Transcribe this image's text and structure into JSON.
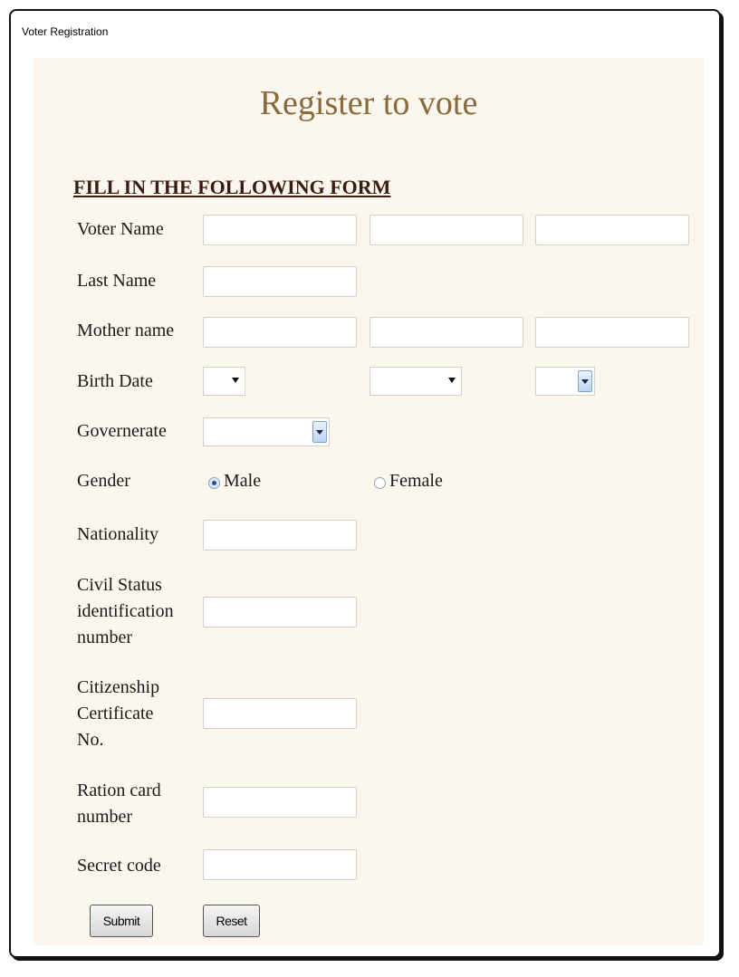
{
  "window": {
    "title": "Voter Registration"
  },
  "form": {
    "heading": "Register to vote",
    "subheading": "FILL IN THE FOLLOWING FORM",
    "labels": {
      "voter_name": "Voter Name",
      "last_name": "Last Name",
      "mother_name": "Mother name",
      "birth_date": "Birth Date",
      "governerate": "Governerate",
      "gender": "Gender",
      "nationality": "Nationality",
      "civil_status_line1": "Civil Status",
      "civil_status_line2": "identification",
      "civil_status_line3": "number",
      "citizenship_line1": "Citizenship",
      "citizenship_line2": "Certificate",
      "citizenship_line3": "No.",
      "ration_line1": "Ration card",
      "ration_line2": "number",
      "secret_code": "Secret code"
    },
    "gender_options": {
      "male": "Male",
      "female": "Female",
      "selected": "Male"
    },
    "buttons": {
      "submit": "Submit",
      "reset": "Reset"
    },
    "values": {
      "voter_first": "",
      "voter_middle": "",
      "voter_last": "",
      "last_name": "",
      "mother_first": "",
      "mother_middle": "",
      "mother_last": "",
      "birth_day": "",
      "birth_month": "",
      "birth_year": "",
      "governerate": "",
      "nationality": "",
      "civil_status": "",
      "citizenship": "",
      "ration_card": "",
      "secret_code": ""
    }
  },
  "colors": {
    "panel_bg": "#fbf6ee",
    "heading": "#8a6a3c",
    "subheading": "#3a1d0f"
  }
}
